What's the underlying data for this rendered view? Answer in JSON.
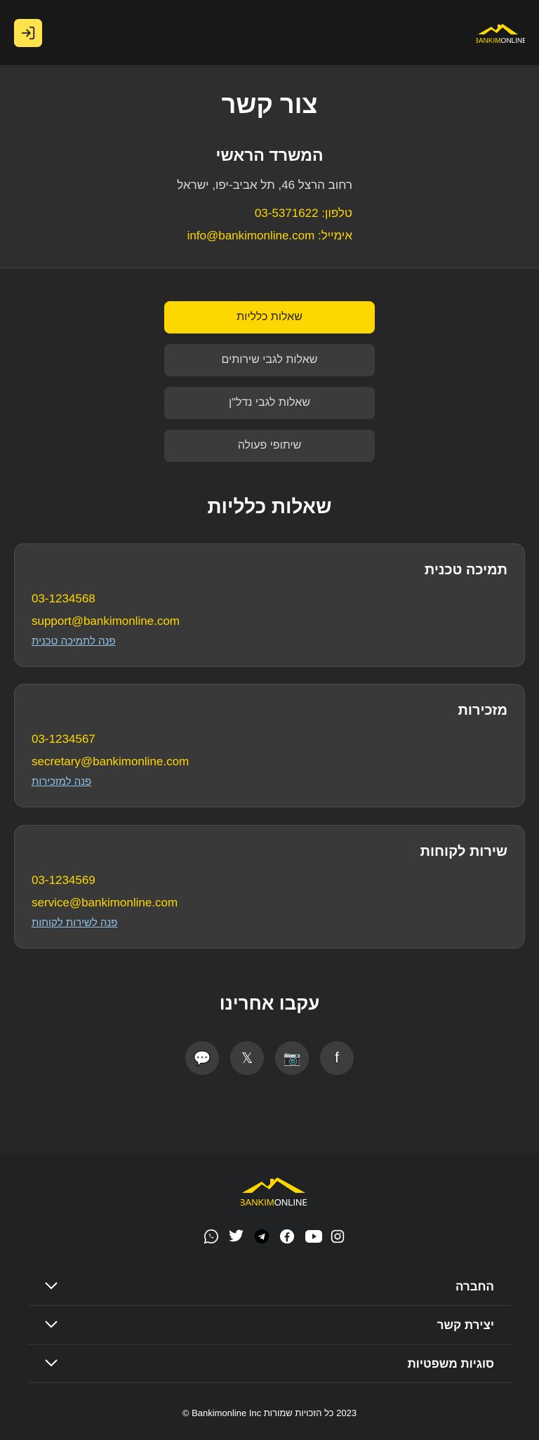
{
  "header": {
    "logo_text": "BANKIMONLINE",
    "logo_left": "BANKIM",
    "logo_right": "ONLINE",
    "login_icon": "login-icon"
  },
  "contact": {
    "title": "צור קשר",
    "office_title": "המשרד הראשי",
    "address": "רחוב הרצל 46, תל אביב-יפו, ישראל",
    "phone_line": "טלפון: 03-5371622",
    "email_line": "אימייל: info@bankimonline.com"
  },
  "tabs": [
    {
      "label": "שאלות כלליות",
      "active": true
    },
    {
      "label": "שאלות לגבי שירותים",
      "active": false
    },
    {
      "label": "שאלות לגבי נדל\"ן",
      "active": false
    },
    {
      "label": "שיתופי פעולה",
      "active": false
    }
  ],
  "section_title": "שאלות כלליות",
  "cards": [
    {
      "title": "תמיכה טכנית",
      "phone": "03-1234568",
      "email": "support@bankimonline.com",
      "link": "פנה לתמיכה טכנית"
    },
    {
      "title": "מזכירות",
      "phone": "03-1234567",
      "email": "secretary@bankimonline.com",
      "link": "פנה למזכירות"
    },
    {
      "title": "שירות לקוחות",
      "phone": "03-1234569",
      "email": "service@bankimonline.com",
      "link": "פנה לשירות לקוחות"
    }
  ],
  "follow": {
    "title": "עקבו אחרינו",
    "icons": [
      {
        "name": "whatsapp-bubble-icon",
        "glyph": "💬"
      },
      {
        "name": "x-icon",
        "glyph": "𝕏"
      },
      {
        "name": "instagram-camera-icon",
        "glyph": "📷"
      },
      {
        "name": "facebook-icon",
        "glyph": "f"
      }
    ]
  },
  "footer": {
    "logo_text": "BANKIMONLINE",
    "logo_left": "BANKIM",
    "logo_right": "ONLINE",
    "social_icons": [
      "whatsapp-icon",
      "twitter-icon",
      "telegram-icon",
      "facebook-icon",
      "youtube-icon",
      "instagram-icon"
    ],
    "accordion": [
      "החברה",
      "יצירת קשר",
      "סוגיות משפטיות"
    ],
    "copyright": "2023 כל הזכויות שמורות Bankimonline Inc ©"
  },
  "colors": {
    "accent": "#ffd700",
    "login_button": "#ffe34d",
    "link": "#8fc3e8",
    "card_bg": "#393939"
  }
}
